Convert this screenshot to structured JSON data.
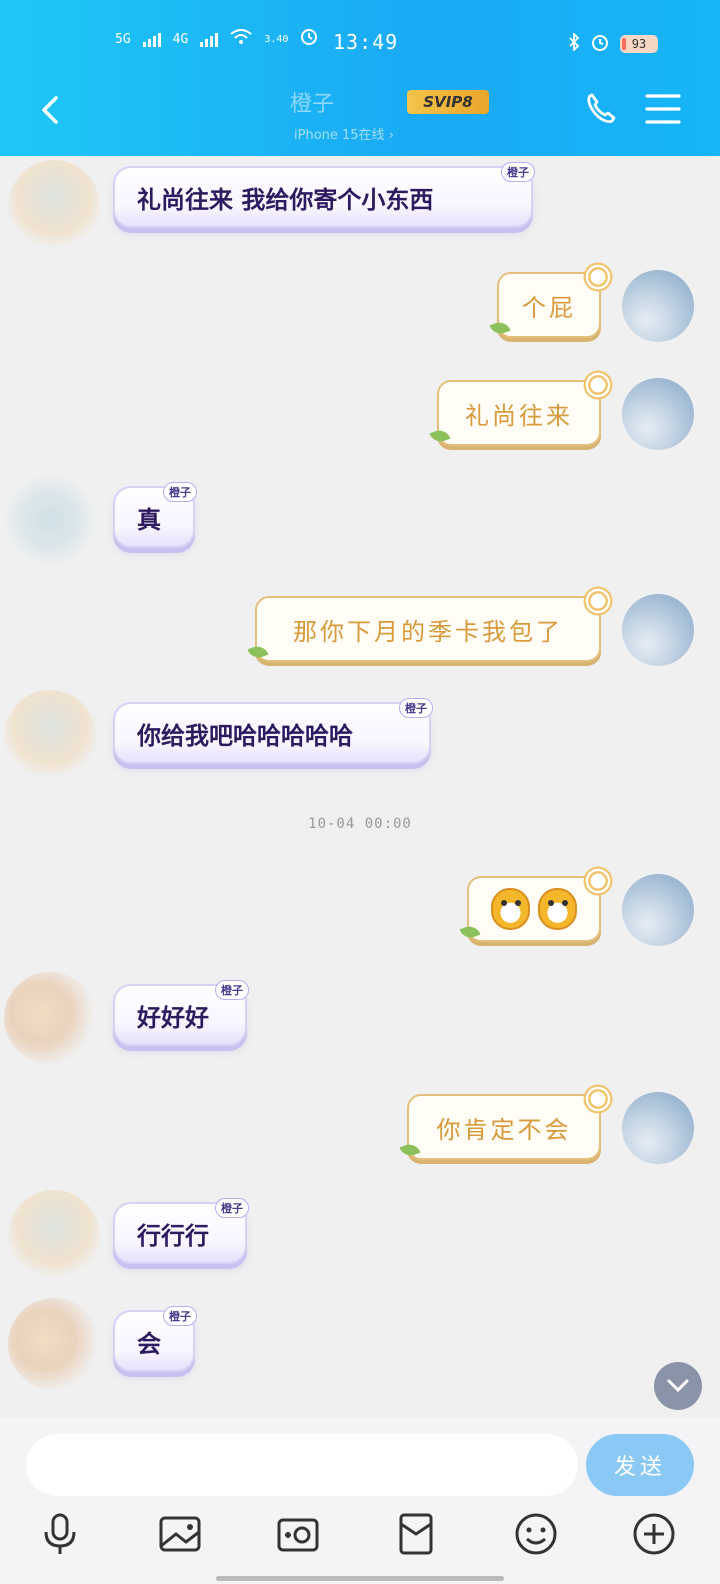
{
  "status_bar": {
    "network1": "5G",
    "network2": "4G",
    "speed": "3.40",
    "time": "13:49",
    "battery": "93"
  },
  "header": {
    "contact_name": "橙子",
    "vip_label": "SVIP8",
    "online_status": "iPhone 15在线 ›"
  },
  "messages": [
    {
      "side": "left",
      "text": "礼尚往来 我给你寄个小东西",
      "tag": "橙子"
    },
    {
      "side": "right",
      "text": "个屁"
    },
    {
      "side": "right",
      "text": "礼尚往来"
    },
    {
      "side": "left",
      "text": "真",
      "tag": "橙子"
    },
    {
      "side": "right",
      "text": "那你下月的季卡我包了"
    },
    {
      "side": "left",
      "text": "你给我吧哈哈哈哈哈",
      "tag": "橙子"
    },
    {
      "type": "time",
      "text": "10-04 00:00"
    },
    {
      "side": "right",
      "emoji": [
        "cat-emoji",
        "cat-emoji"
      ]
    },
    {
      "side": "left",
      "text": "好好好",
      "tag": "橙子"
    },
    {
      "side": "right",
      "text": "你肯定不会"
    },
    {
      "side": "left",
      "text": "行行行",
      "tag": "橙子"
    },
    {
      "side": "left",
      "text": "会",
      "tag": "橙子"
    }
  ],
  "input": {
    "placeholder": "",
    "send_label": "发送"
  },
  "toolbar": [
    "microphone-icon",
    "image-icon",
    "camera-icon",
    "red-packet-icon",
    "emoji-icon",
    "plus-icon"
  ],
  "colors": {
    "header": "#1aa9f4",
    "send_button": "#8ac8f5",
    "right_bubble_text": "#d89a3a",
    "left_bubble_text": "#2e1a5e"
  }
}
